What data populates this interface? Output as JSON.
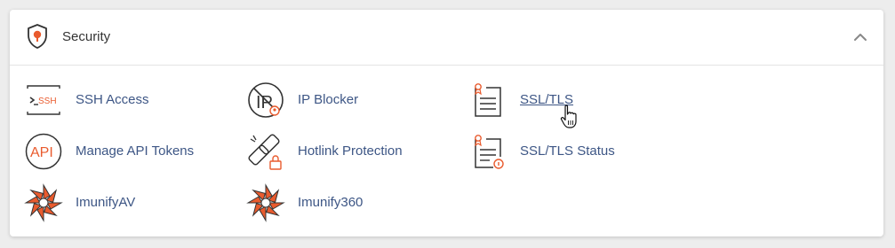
{
  "section": {
    "title": "Security",
    "icon": "shield-icon",
    "accent": "#e95b2e",
    "label_color": "#3d5685"
  },
  "items": [
    {
      "label": "SSH Access",
      "icon": "ssh-terminal-icon"
    },
    {
      "label": "IP Blocker",
      "icon": "ip-blocker-icon"
    },
    {
      "label": "SSL/TLS",
      "icon": "certificate-icon"
    },
    {
      "label": "Manage API Tokens",
      "icon": "api-icon"
    },
    {
      "label": "Hotlink Protection",
      "icon": "broken-link-icon"
    },
    {
      "label": "SSL/TLS Status",
      "icon": "certificate-status-icon"
    },
    {
      "label": "ImunifyAV",
      "icon": "imunify-icon"
    },
    {
      "label": "Imunify360",
      "icon": "imunify360-icon"
    }
  ]
}
